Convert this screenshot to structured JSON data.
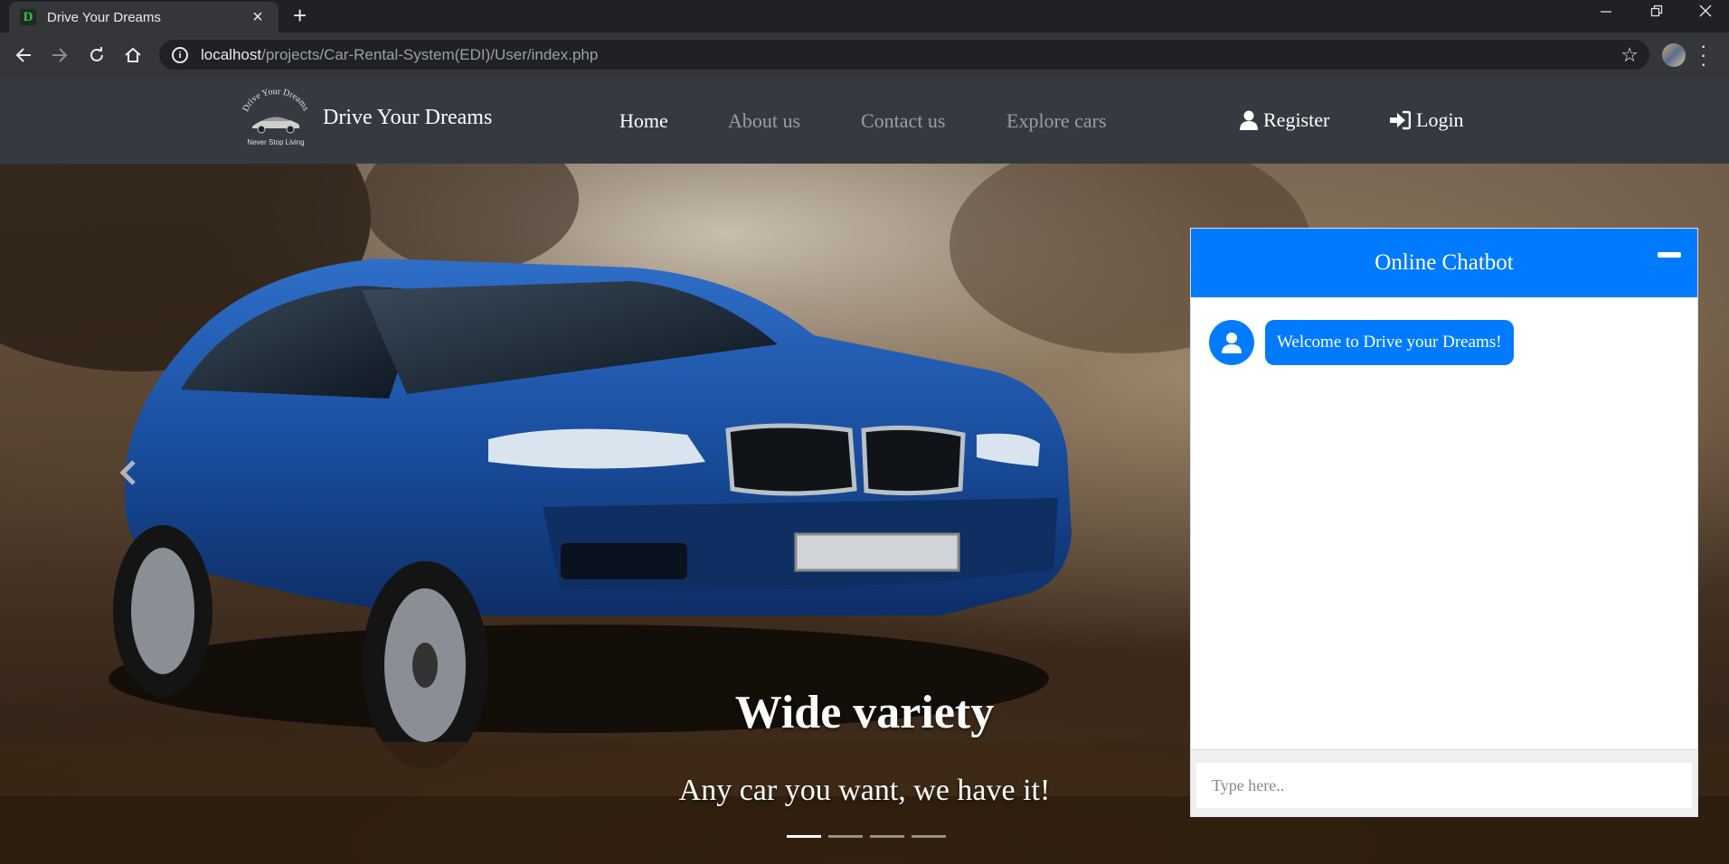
{
  "browser": {
    "tab_title": "Drive Your Dreams",
    "favicon_letter": "D",
    "new_tab_glyph": "+",
    "url_host": "localhost",
    "url_path": "/projects/Car-Rental-System(EDI)/User/index.php"
  },
  "navbar": {
    "brand": "Drive Your Dreams",
    "logo_arc_text": "Drive Your Dreams",
    "logo_tagline": "Never Stop Living",
    "links": [
      "Home",
      "About us",
      "Contact us",
      "Explore cars"
    ],
    "register": "Register",
    "login": "Login"
  },
  "carousel": {
    "title": "Wide variety",
    "subtitle": "Any car you want, we have it!",
    "slide_count": 4,
    "active_slide": 1
  },
  "chatbot": {
    "header": "Online Chatbot",
    "messages": [
      {
        "from": "bot",
        "text": "Welcome to Drive your Dreams!"
      }
    ],
    "input_placeholder": "Type here.."
  },
  "colors": {
    "accent": "#007bff",
    "navbar_bg": "#343a40",
    "chrome_bg": "#202124"
  }
}
